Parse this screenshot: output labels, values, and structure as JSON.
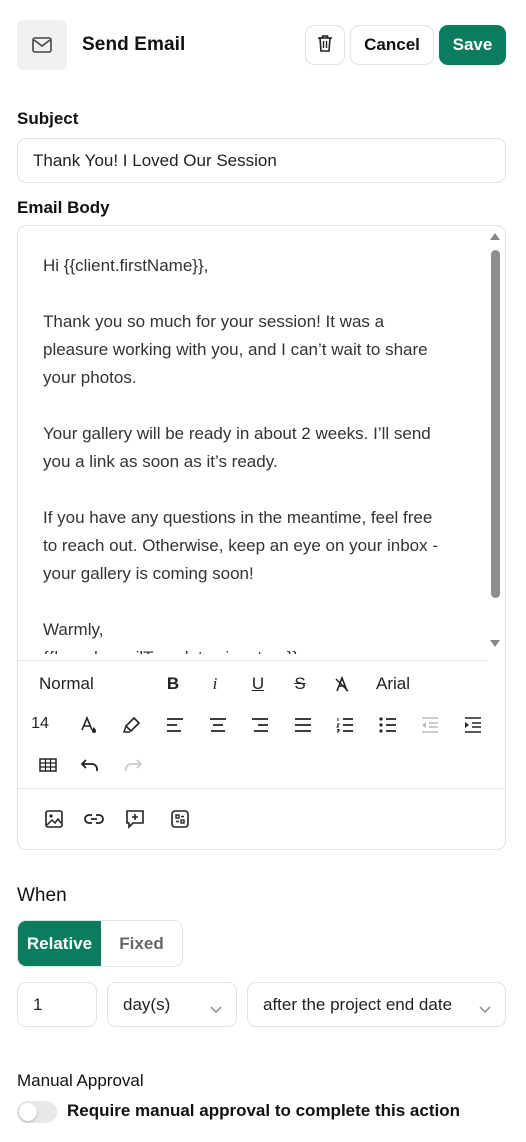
{
  "header": {
    "title": "Send Email",
    "icon": "envelope-icon",
    "delete_icon": "trash-icon",
    "cancel_label": "Cancel",
    "save_label": "Save",
    "accent_color": "#0b7d5e"
  },
  "subject": {
    "label": "Subject",
    "value": "Thank You! I Loved Our Session"
  },
  "body": {
    "label": "Email Body",
    "lines": [
      "Hi {{client.firstName}},",
      "",
      "Thank you so much for your session! It was a",
      "pleasure working with you, and I can’t wait to share",
      "your photos.",
      "",
      "Your gallery will be ready in about 2 weeks. I’ll send",
      "you a link as soon as it’s ready.",
      "",
      "If you have any questions in the meantime, feel free",
      "to reach out. Otherwise, keep an eye on your inbox -",
      "your gallery is coming soon!",
      "",
      "Warmly,",
      "{{brand.emailTemplate.signature}}"
    ]
  },
  "toolbar": {
    "paragraph_style": "Normal",
    "font_family": "Arial",
    "font_size": "14",
    "bold_label": "B",
    "italic_label": "i",
    "underline_label": "U",
    "strike_label": "S",
    "icons": [
      "bold-icon",
      "italic-icon",
      "underline-icon",
      "strikethrough-icon",
      "clear-format-icon",
      "text-color-icon",
      "highlight-icon",
      "align-left-icon",
      "align-center-icon",
      "align-right-icon",
      "align-justify-icon",
      "ordered-list-icon",
      "bullet-list-icon",
      "outdent-icon",
      "indent-icon",
      "table-icon",
      "undo-icon",
      "redo-icon",
      "image-icon",
      "link-icon",
      "insert-variable-icon",
      "template-icon"
    ]
  },
  "when": {
    "label": "When",
    "options": [
      "Relative",
      "Fixed"
    ],
    "selected": "Relative",
    "amount": "1",
    "unit": "day(s)",
    "reference": "after the project end date"
  },
  "approval": {
    "label": "Manual Approval",
    "toggle_label": "Require manual approval to complete this action",
    "enabled": false
  }
}
